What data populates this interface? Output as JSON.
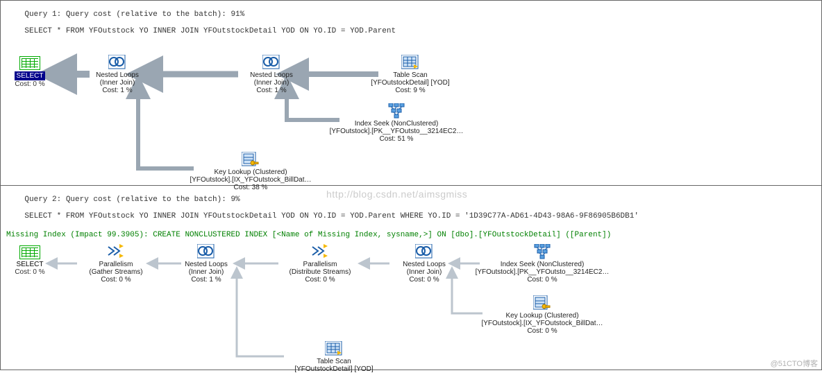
{
  "watermark": "http://blog.csdn.net/aimsgmiss",
  "brand": "@51CTO博客",
  "query1": {
    "header_line1": "Query 1: Query cost (relative to the batch): 91%",
    "header_line2": "SELECT * FROM YFOutstock YO INNER JOIN YFOutstockDetail YOD ON YO.ID = YOD.Parent",
    "select": {
      "label": "SELECT",
      "cost": "Cost: 0 %"
    },
    "nodes": {
      "nl1": {
        "label": "Nested Loops",
        "sub": "(Inner Join)",
        "cost": "Cost: 1 %"
      },
      "nl2": {
        "label": "Nested Loops",
        "sub": "(Inner Join)",
        "cost": "Cost: 1 %"
      },
      "tscan": {
        "label": "Table Scan",
        "sub": "[YFOutstockDetail] [YOD]",
        "cost": "Cost: 9 %"
      },
      "iseek": {
        "label": "Index Seek (NonClustered)",
        "sub": "[YFOutstock].[PK__YFOutsto__3214EC2…",
        "cost": "Cost: 51 %"
      },
      "klook": {
        "label": "Key Lookup (Clustered)",
        "sub": "[YFOutstock].[IX_YFOutstock_BillDat…",
        "cost": "Cost: 38 %"
      }
    }
  },
  "query2": {
    "header_line1": "Query 2: Query cost (relative to the batch): 9%",
    "header_line2": "SELECT * FROM YFOutstock YO INNER JOIN YFOutstockDetail YOD ON YO.ID = YOD.Parent WHERE YO.ID = '1D39C77A-AD61-4D43-98A6-9F86905B6DB1'",
    "missing_index": "Missing Index (Impact 99.3905): CREATE NONCLUSTERED INDEX [<Name of Missing Index, sysname,>] ON [dbo].[YFOutstockDetail] ([Parent])",
    "select": {
      "label": "SELECT",
      "cost": "Cost: 0 %"
    },
    "nodes": {
      "par1": {
        "label": "Parallelism",
        "sub": "(Gather Streams)",
        "cost": "Cost: 0 %"
      },
      "nl1": {
        "label": "Nested Loops",
        "sub": "(Inner Join)",
        "cost": "Cost: 1 %"
      },
      "par2": {
        "label": "Parallelism",
        "sub": "(Distribute Streams)",
        "cost": "Cost: 0 %"
      },
      "nl2": {
        "label": "Nested Loops",
        "sub": "(Inner Join)",
        "cost": "Cost: 0 %"
      },
      "iseek": {
        "label": "Index Seek (NonClustered)",
        "sub": "[YFOutstock].[PK__YFOutsto__3214EC2…",
        "cost": "Cost: 0 %"
      },
      "klook": {
        "label": "Key Lookup (Clustered)",
        "sub": "[YFOutstock].[IX_YFOutstock_BillDat…",
        "cost": "Cost: 0 %"
      },
      "tscan": {
        "label": "Table Scan",
        "sub": "[YFOutstockDetail] [YOD]",
        "cost": ""
      }
    }
  }
}
